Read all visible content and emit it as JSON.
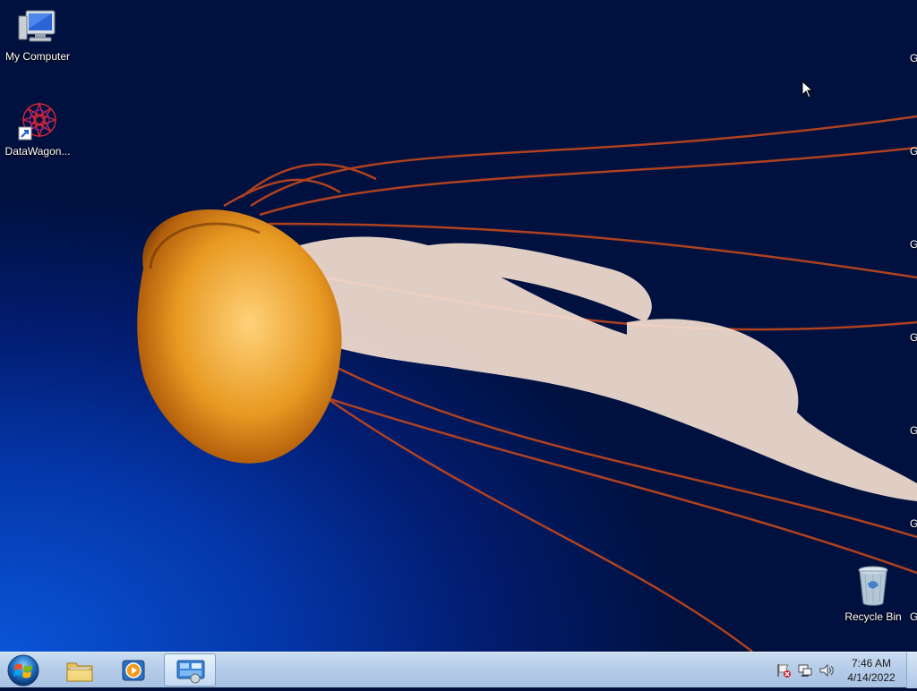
{
  "desktop": {
    "icons": [
      {
        "label": "My Computer",
        "icon": "computer-icon"
      },
      {
        "label": "DataWagon...",
        "icon": "datawagon-shortcut-icon"
      },
      {
        "label": "Recycle Bin",
        "icon": "recycle-bin-icon"
      }
    ],
    "edge_letters": [
      "G",
      "G",
      "G",
      "G",
      "G",
      "G",
      "G"
    ]
  },
  "taskbar": {
    "start_icon": "windows-start-orb",
    "pinned": [
      {
        "name": "file-explorer",
        "icon": "folder-icon"
      },
      {
        "name": "media-player",
        "icon": "media-player-icon"
      },
      {
        "name": "control-panel",
        "icon": "control-panel-icon"
      }
    ],
    "tray_icons": [
      "action-center-flag-icon",
      "network-icon",
      "volume-icon"
    ],
    "clock": {
      "time": "7:46 AM",
      "date": "4/14/2022"
    }
  },
  "colors": {
    "taskbar": "#b6cde9",
    "wallpaper_deep": "#00113f",
    "wallpaper_light": "#0a55d8"
  }
}
